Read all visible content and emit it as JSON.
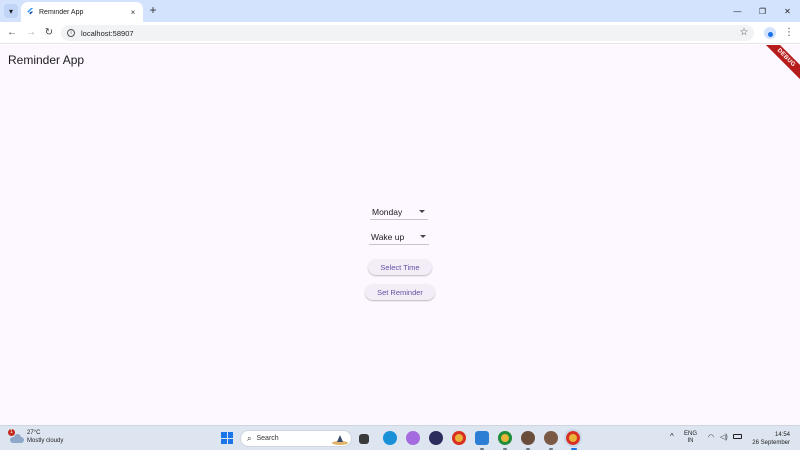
{
  "browser": {
    "tab_title": "Reminder App",
    "url": "localhost:58907",
    "new_tab_symbol": "+",
    "tab_close_symbol": "×"
  },
  "app": {
    "title": "Reminder App",
    "debug_banner": "DEBUG",
    "day_dropdown": {
      "selected": "Monday"
    },
    "task_dropdown": {
      "selected": "Wake up"
    },
    "select_time_label": "Select Time",
    "set_reminder_label": "Set Reminder",
    "background_color": "#fdf7ff",
    "accent_color": "#6750a4"
  },
  "taskbar": {
    "weather": {
      "temp": "27°C",
      "condition": "Mostly cloudy",
      "badge": "1"
    },
    "search_placeholder": "Search",
    "language": {
      "line1": "ENG",
      "line2": "IN"
    },
    "clock": {
      "time": "14:54",
      "date": "26 September"
    }
  }
}
